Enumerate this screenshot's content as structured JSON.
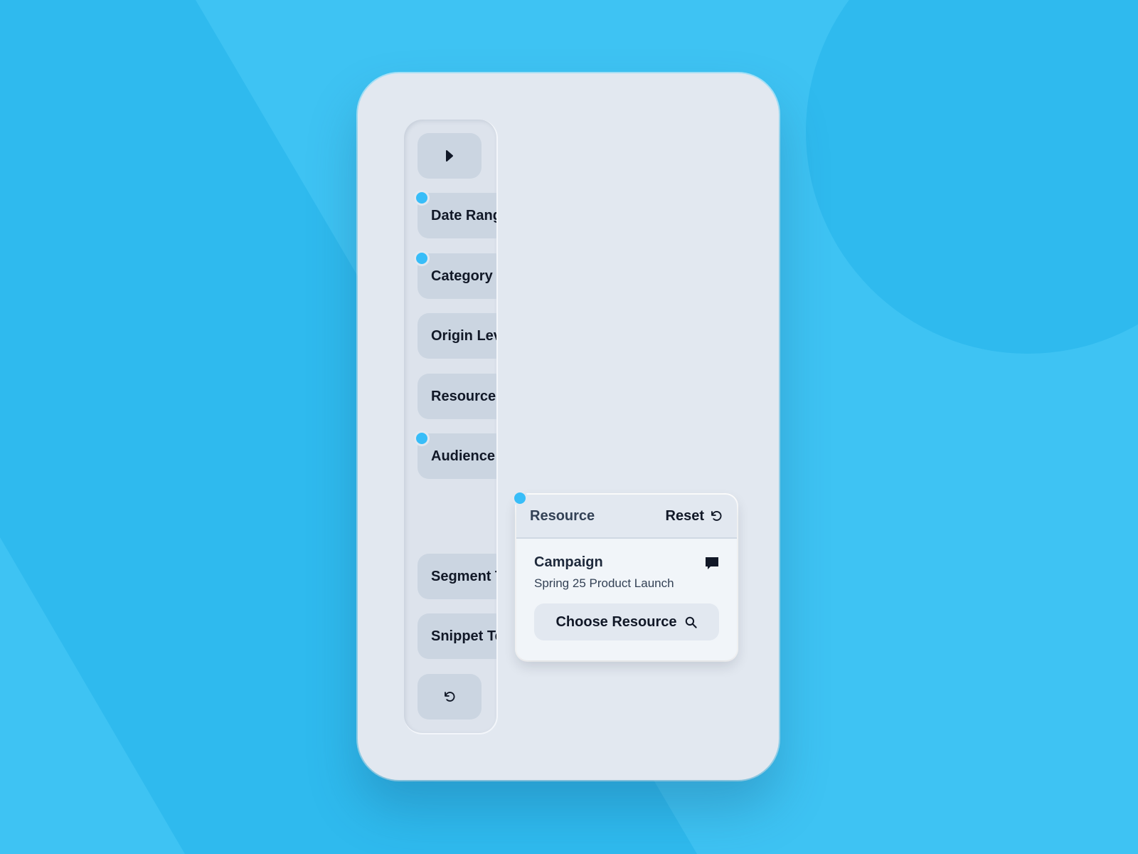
{
  "colors": {
    "background": "#3ec3f3",
    "background_shade": "#2fbaee",
    "card": "#e2e8f0",
    "accent_dot": "#38bdf8"
  },
  "rail": {
    "toggle_icon": "play-right-icon",
    "items": [
      {
        "label": "Date Range",
        "active_dot": true
      },
      {
        "label": "Category",
        "active_dot": true
      },
      {
        "label": "Origin Level",
        "active_dot": false
      },
      {
        "label": "Resource",
        "active_dot": false
      },
      {
        "label": "Audience",
        "active_dot": true
      },
      {
        "label": "Segment Type",
        "active_dot": false
      },
      {
        "label": "Snippet Text",
        "active_dot": false
      }
    ],
    "reset_icon": "reset-icon"
  },
  "panel": {
    "title": "Resource",
    "reset_label": "Reset",
    "resource_type": "Campaign",
    "resource_name": "Spring 25 Product Launch",
    "comment_icon": "comment-icon",
    "choose_label": "Choose Resource",
    "choose_icon": "search-icon"
  }
}
